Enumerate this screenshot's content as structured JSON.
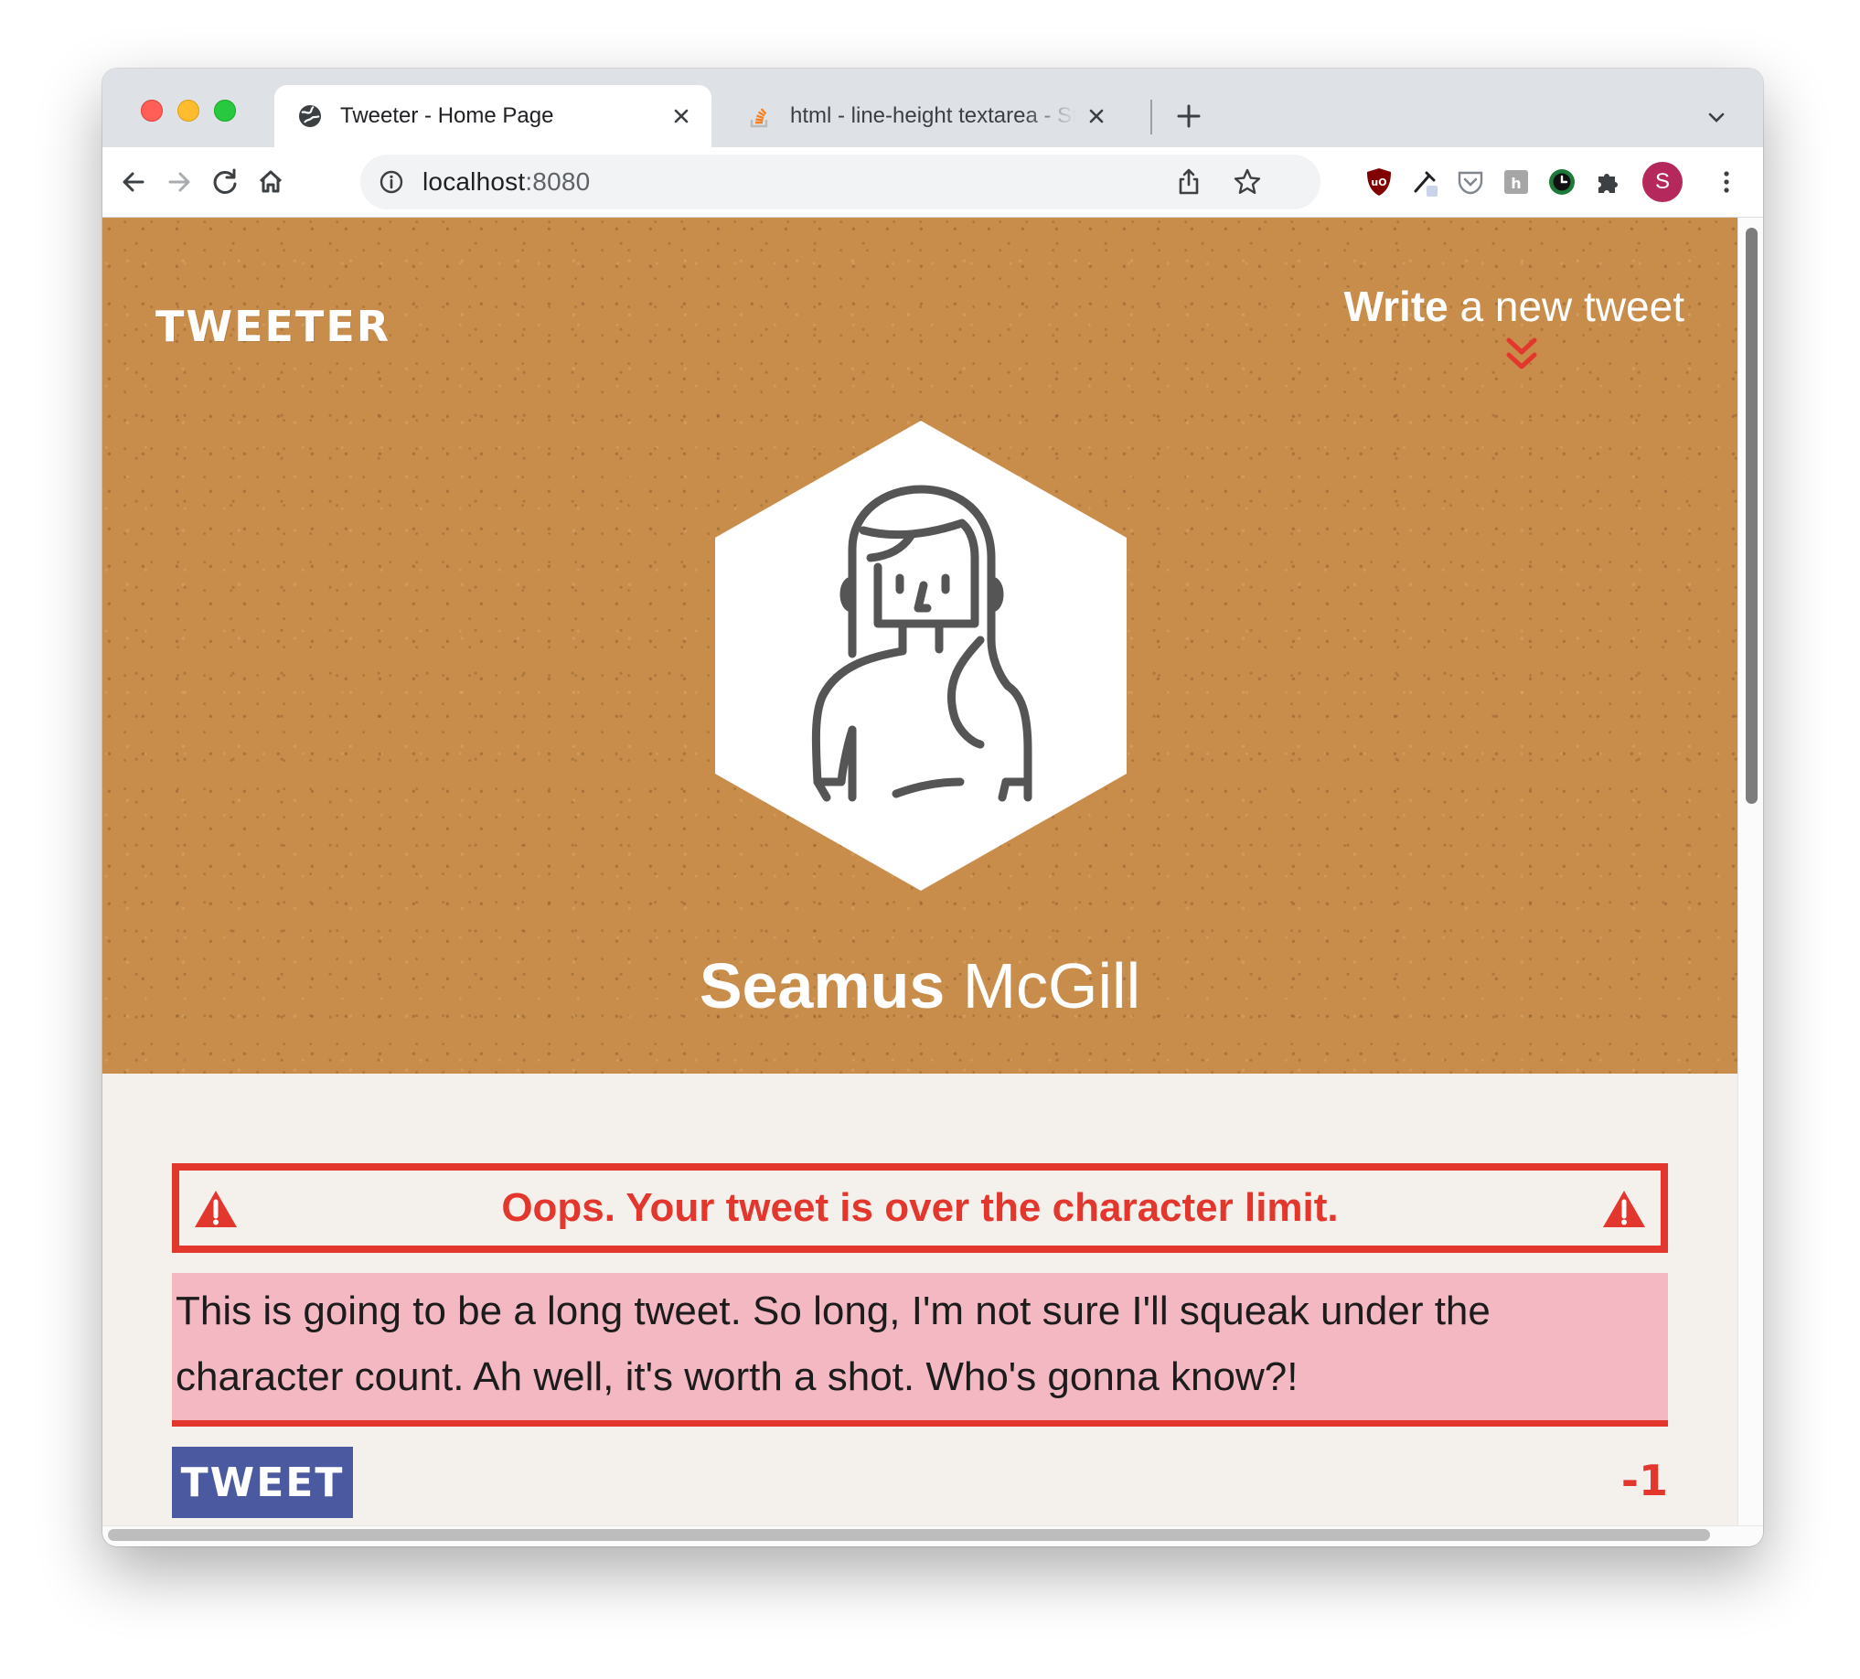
{
  "browser": {
    "tabs": [
      {
        "title": "Tweeter - Home Page",
        "icon": "globe-icon",
        "active": true
      },
      {
        "title": "html - line-height textarea - Stack Overflow",
        "icon": "stackoverflow-icon",
        "active": false
      }
    ],
    "address": {
      "host": "localhost",
      "port": ":8080"
    },
    "profile_initial": "S",
    "extensions": [
      "ublock-origin-icon",
      "eyedropper-icon",
      "pocket-icon",
      "hypothesis-icon",
      "clock-icon",
      "puzzle-icon"
    ]
  },
  "page": {
    "brand": "TWEETER",
    "write_link": {
      "strong": "Write",
      "rest": " a new tweet"
    },
    "profile_name": {
      "first": "Seamus",
      "last": " McGill"
    },
    "error_message": "Oops. Your tweet is over the character limit.",
    "tweet_text": "This is going to be a long tweet. So long, I'm not sure I'll squeak under the character count. Ah well, it's worth a shot. Who's gonna know?!",
    "tweet_button": "TWEET",
    "char_counter": "-1"
  },
  "colors": {
    "hero_bg": "#c98d4b",
    "accent_red": "#e3372e",
    "tweet_button_bg": "#4b5aa0",
    "textarea_error_bg": "#f4b8c3",
    "page_bg": "#f4f1ec"
  }
}
